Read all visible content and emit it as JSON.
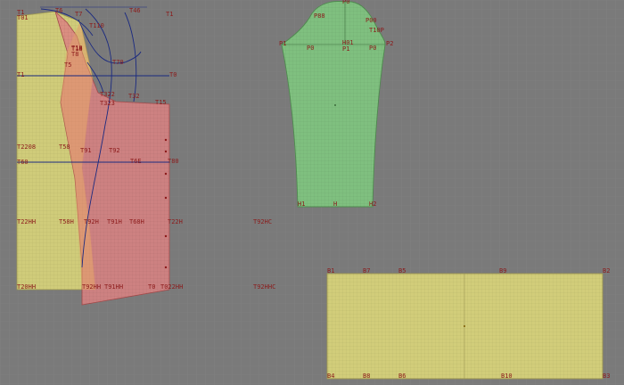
{
  "workspace": {
    "background": "#7a7a7a",
    "grid_color": "#838383",
    "label_color": "#8b1a1a",
    "curve_color": "#1b2a80"
  },
  "front_piece": {
    "color": "#d7d27a",
    "labels": {
      "top_left": "Т1",
      "top_left_2": "Т01",
      "neck": "Т6",
      "shoulder": "Т7",
      "shoulder_2": "Т18",
      "armhole": "Т5",
      "chest": "Т1",
      "waist": "Т2208",
      "waist_line": "Т60",
      "hip": "Т22НН",
      "hem": "Т20НН"
    }
  },
  "back_piece": {
    "color": "#d98a8a",
    "labels": {
      "top": "Т46",
      "top_right": "Т1",
      "dart_1": "Т18",
      "dart_2": "Т8",
      "armhole_1": "Т110",
      "armhole_2": "Т70",
      "armhole_3": "Т322",
      "armhole_4": "Т323",
      "side_1": "Т32",
      "side_2": "Т15",
      "waist": "Т58",
      "waist_2": "Т91",
      "waist_3": "Т92",
      "waist_line": "Т6Е",
      "waist_right": "Т80",
      "hip_1": "Т58Н",
      "hip_2": "Т92Н",
      "hip_3": "Т91Н",
      "hip_4": "Т68Н",
      "hip_5": "Т22Н",
      "hem_1": "Т92НН",
      "hem_2": "Т91НН",
      "hem_3": "Т0",
      "hem_4": "Т022НН",
      "center_right": "Т0"
    }
  },
  "floating_labels": {
    "hip_far": "Т92НС",
    "hem_far": "Т92ННС"
  },
  "sleeve": {
    "color": "#7fc47f",
    "labels": {
      "cap_top": "Р0",
      "cap_left": "Р88",
      "cap_right": "Р00",
      "cap_right_2": "Т10Р",
      "left": "Р1",
      "mid_left": "Р0",
      "center": "Н01",
      "center_2": "Р1",
      "mid_right": "Р0",
      "right": "Р2",
      "bottom_left": "Н1",
      "bottom_mid": "Н",
      "bottom_right": "Н2"
    }
  },
  "rectangle_piece": {
    "color": "#d7d27a",
    "labels": {
      "top_1": "В1",
      "top_2": "В7",
      "top_3": "В5",
      "top_4": "В9",
      "top_5": "В2",
      "bottom_1": "В4",
      "bottom_2": "В8",
      "bottom_3": "В6",
      "bottom_4": "В10",
      "bottom_5": "В3"
    }
  }
}
